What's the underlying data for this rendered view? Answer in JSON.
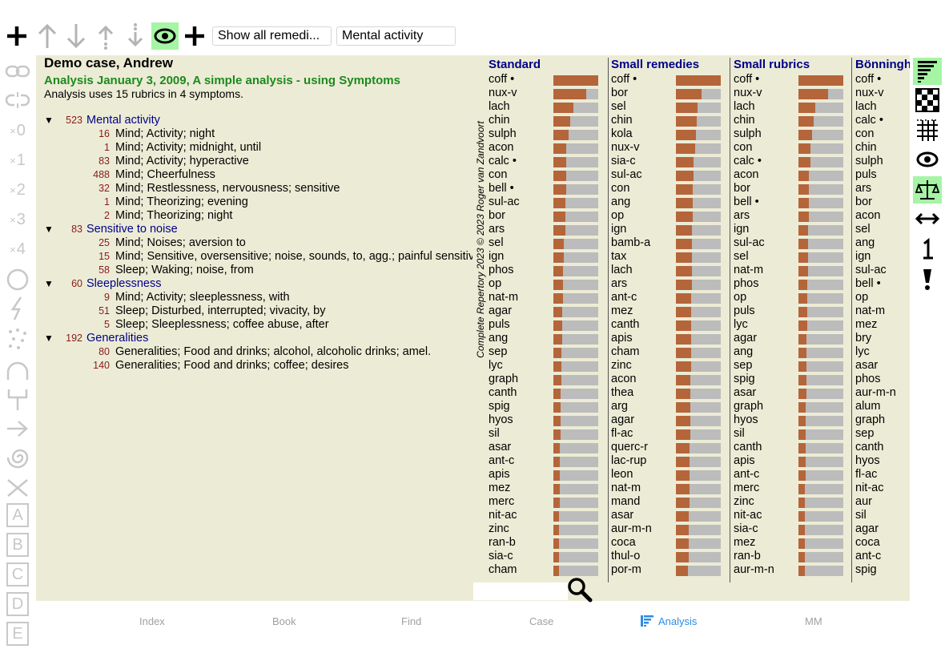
{
  "toolbar": {
    "show_all_label": "Show all remedi...",
    "filter_value": "Mental activity"
  },
  "left_toolbar": {
    "x0": "0",
    "x1": "1",
    "x2": "2",
    "x3": "3",
    "x4": "4",
    "letters": [
      "A",
      "B",
      "C",
      "D",
      "E"
    ]
  },
  "case": {
    "title": "Demo case, Andrew",
    "analysis": "Analysis January 3, 2009, A simple analysis - using Symptoms",
    "summary": "Analysis uses 15 rubrics in 4 symptoms."
  },
  "symptoms": [
    {
      "count": "523",
      "name": "Mental activity",
      "rubrics": [
        {
          "count": "16",
          "name": "Mind; Activity; night"
        },
        {
          "count": "1",
          "name": "Mind; Activity; midnight, until"
        },
        {
          "count": "83",
          "name": "Mind; Activity; hyperactive"
        },
        {
          "count": "488",
          "name": "Mind; Cheerfulness"
        },
        {
          "count": "32",
          "name": "Mind; Restlessness, nervousness; sensitive"
        },
        {
          "count": "1",
          "name": "Mind; Theorizing; evening"
        },
        {
          "count": "2",
          "name": "Mind; Theorizing; night"
        }
      ]
    },
    {
      "count": "83",
      "name": "Sensitive to noise",
      "rubrics": [
        {
          "count": "25",
          "name": "Mind; Noises; aversion to"
        },
        {
          "count": "15",
          "name": "Mind; Sensitive, oversensitive; noise, sounds, to, agg.; painful sensitiveness to"
        },
        {
          "count": "58",
          "name": "Sleep; Waking; noise, from"
        }
      ]
    },
    {
      "count": "60",
      "name": "Sleeplessness",
      "rubrics": [
        {
          "count": "9",
          "name": "Mind; Activity; sleeplessness, with"
        },
        {
          "count": "51",
          "name": "Sleep; Disturbed, interrupted; vivacity, by"
        },
        {
          "count": "5",
          "name": "Sleep; Sleeplessness; coffee abuse, after"
        }
      ]
    },
    {
      "count": "192",
      "name": "Generalities",
      "rubrics": [
        {
          "count": "80",
          "name": "Generalities; Food and drinks; alcohol, alcoholic drinks; amel."
        },
        {
          "count": "140",
          "name": "Generalities; Food and drinks; coffee; desires"
        }
      ]
    }
  ],
  "copyright": "Complete Repertory 2023 © 2023 Roger van Zandvoort",
  "columns": [
    {
      "title": "Standard",
      "remedies": [
        "coff •",
        "nux-v",
        "lach",
        "chin",
        "sulph",
        "acon",
        "calc •",
        "con",
        "bell •",
        "sul-ac",
        "bor",
        "ars",
        "sel",
        "ign",
        "phos",
        "op",
        "nat-m",
        "agar",
        "puls",
        "ang",
        "sep",
        "lyc",
        "graph",
        "canth",
        "spig",
        "hyos",
        "sil",
        "asar",
        "ant-c",
        "apis",
        "mez",
        "merc",
        "nit-ac",
        "zinc",
        "ran-b",
        "sia-c",
        "cham"
      ],
      "scores": [
        1.0,
        0.74,
        0.44,
        0.38,
        0.34,
        0.28,
        0.28,
        0.28,
        0.28,
        0.26,
        0.26,
        0.26,
        0.24,
        0.24,
        0.22,
        0.22,
        0.22,
        0.2,
        0.2,
        0.2,
        0.18,
        0.18,
        0.18,
        0.16,
        0.16,
        0.16,
        0.16,
        0.14,
        0.14,
        0.14,
        0.14,
        0.14,
        0.12,
        0.12,
        0.12,
        0.12,
        0.12
      ]
    },
    {
      "title": "Small remedies",
      "remedies": [
        "coff •",
        "bor",
        "sel",
        "chin",
        "kola",
        "nux-v",
        "sia-c",
        "sul-ac",
        "con",
        "ang",
        "op",
        "ign",
        "bamb-a",
        "tax",
        "lach",
        "ars",
        "ant-c",
        "mez",
        "canth",
        "apis",
        "cham",
        "zinc",
        "acon",
        "thea",
        "arg",
        "agar",
        "fl-ac",
        "querc-r",
        "lac-rup",
        "leon",
        "nat-m",
        "mand",
        "asar",
        "aur-m-n",
        "coca",
        "thul-o",
        "por-m"
      ],
      "scores": [
        1.0,
        0.58,
        0.48,
        0.46,
        0.44,
        0.42,
        0.4,
        0.4,
        0.38,
        0.38,
        0.38,
        0.36,
        0.36,
        0.36,
        0.36,
        0.36,
        0.34,
        0.34,
        0.34,
        0.34,
        0.34,
        0.34,
        0.32,
        0.32,
        0.32,
        0.32,
        0.32,
        0.3,
        0.3,
        0.3,
        0.3,
        0.3,
        0.28,
        0.28,
        0.28,
        0.28,
        0.26
      ]
    },
    {
      "title": "Small rubrics",
      "remedies": [
        "coff •",
        "nux-v",
        "lach",
        "chin",
        "sulph",
        "con",
        "calc •",
        "acon",
        "bor",
        "bell •",
        "ars",
        "ign",
        "sul-ac",
        "sel",
        "nat-m",
        "phos",
        "op",
        "puls",
        "lyc",
        "agar",
        "ang",
        "sep",
        "spig",
        "asar",
        "graph",
        "hyos",
        "sil",
        "canth",
        "apis",
        "ant-c",
        "merc",
        "zinc",
        "nit-ac",
        "sia-c",
        "mez",
        "ran-b",
        "aur-m-n"
      ],
      "scores": [
        1.0,
        0.66,
        0.38,
        0.34,
        0.3,
        0.26,
        0.26,
        0.24,
        0.24,
        0.24,
        0.24,
        0.22,
        0.22,
        0.22,
        0.22,
        0.2,
        0.2,
        0.2,
        0.2,
        0.18,
        0.18,
        0.18,
        0.18,
        0.18,
        0.16,
        0.16,
        0.16,
        0.16,
        0.16,
        0.16,
        0.14,
        0.14,
        0.14,
        0.14,
        0.14,
        0.14,
        0.14
      ]
    },
    {
      "title": "Bönninghausen",
      "remedies": [
        "coff •",
        "nux-v",
        "lach",
        "calc •",
        "con",
        "chin",
        "sulph",
        "puls",
        "ars",
        "bor",
        "acon",
        "sel",
        "ang",
        "ign",
        "sul-ac",
        "bell •",
        "op",
        "nat-m",
        "mez",
        "bry",
        "lyc",
        "asar",
        "phos",
        "aur-m-n",
        "alum",
        "graph",
        "sep",
        "canth",
        "hyos",
        "fl-ac",
        "nit-ac",
        "aur",
        "sil",
        "agar",
        "coca",
        "ant-c",
        "spig"
      ],
      "scores": []
    }
  ],
  "bottom_nav": {
    "index": "Index",
    "book": "Book",
    "find": "Find",
    "case": "Case",
    "analysis": "Analysis",
    "mm": "MM"
  }
}
